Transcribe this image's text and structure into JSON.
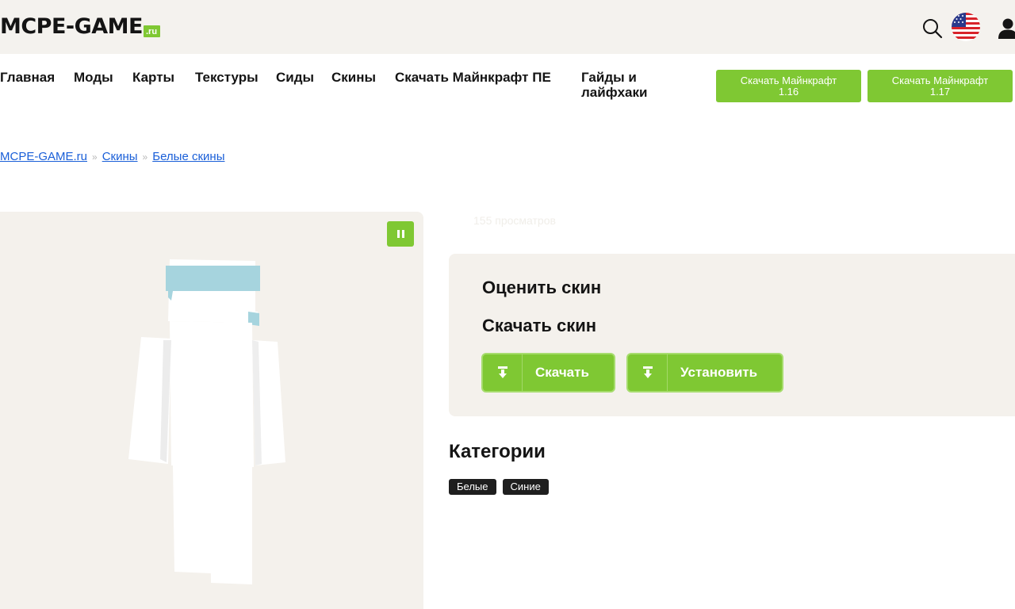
{
  "header": {
    "logo_text": "MCPE-GAME",
    "logo_suffix": ".ru",
    "icons": [
      "search-icon",
      "us-flag-icon",
      "user-icon"
    ]
  },
  "nav": {
    "items": [
      {
        "label": "Главная"
      },
      {
        "label": "Моды"
      },
      {
        "label": "Карты"
      },
      {
        "label": "Текстуры"
      },
      {
        "label": "Сиды"
      },
      {
        "label": "Скины"
      },
      {
        "label": "Скачать Майнкрафт ПЕ"
      },
      {
        "label": "Гайды и лайфхаки"
      }
    ],
    "buttons": [
      {
        "label": "Скачать Майнкрафт 1.16"
      },
      {
        "label": "Скачать Майнкрафт 1.17"
      }
    ]
  },
  "breadcrumb": {
    "items": [
      "MCPE-GAME.ru",
      "Скины",
      "Белые скины"
    ],
    "separator": "»"
  },
  "viewer": {
    "pause_icon": "pause-icon"
  },
  "stats": {
    "views": "155 просматров"
  },
  "panel": {
    "rate_title": "Оценить скин",
    "download_title": "Скачать скин",
    "download_label": "Скачать",
    "install_label": "Установить"
  },
  "categories": {
    "title": "Категории",
    "tags": [
      "Белые",
      "Синие"
    ]
  },
  "colors": {
    "accent": "#7fc833",
    "header_bg": "#f4f2ee",
    "panel_bg": "#f4f1ec",
    "link": "#1a5fd8",
    "tag_bg": "#1e1e1e"
  }
}
